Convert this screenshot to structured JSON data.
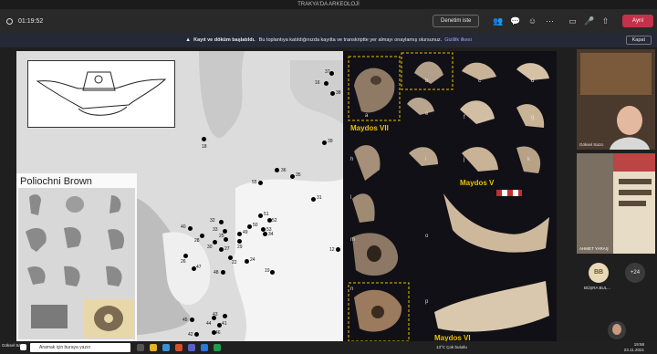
{
  "window": {
    "title": "TRAKYA'DA ARKEOLOJİ"
  },
  "toolbar": {
    "timer": "01:19:52",
    "request_control_label": "Denetim iste",
    "leave_label": "Ayrıl"
  },
  "banner": {
    "title": "Kayıt ve döküm başlatıldı.",
    "message": "Bu toplantıya katıldığınızda kayıtta ve transkriptte yer almayı onaylamış olursunuz.",
    "link": "Gizlilik ilkesi",
    "close_label": "Kapat"
  },
  "slide": {
    "poliochni_label": "Poliochni Brown",
    "map_numbers": [
      "37",
      "16",
      "38",
      "18",
      "39",
      "36",
      "35",
      "31",
      "32",
      "33",
      "40",
      "25",
      "28",
      "26",
      "30",
      "27",
      "29",
      "47",
      "49",
      "50",
      "51",
      "52",
      "53",
      "55",
      "34",
      "19",
      "24",
      "22",
      "48",
      "43",
      "44",
      "41",
      "45",
      "46",
      "42",
      "12"
    ],
    "maydos_vii": "Maydos VII",
    "maydos_v": "Maydos V",
    "maydos_vi": "Maydos VI",
    "photo_letters": [
      "a",
      "b",
      "c",
      "d",
      "e",
      "f",
      "g",
      "h",
      "i",
      "j",
      "k",
      "l",
      "m",
      "n",
      "o",
      "p"
    ]
  },
  "participants": {
    "speaker_name": "Göksel Sazcı",
    "second_name": "AHMET YARAŞ",
    "bb_initials": "BB",
    "bb_name": "BÜŞRA BUL...",
    "more_count": "+24",
    "self_label": "Göksel Sazcı"
  },
  "taskbar": {
    "search_placeholder": "Aramak için buraya yazın",
    "weather": "13°C Çok bulutlu",
    "time": "19:58",
    "date": "23.11.2021"
  }
}
